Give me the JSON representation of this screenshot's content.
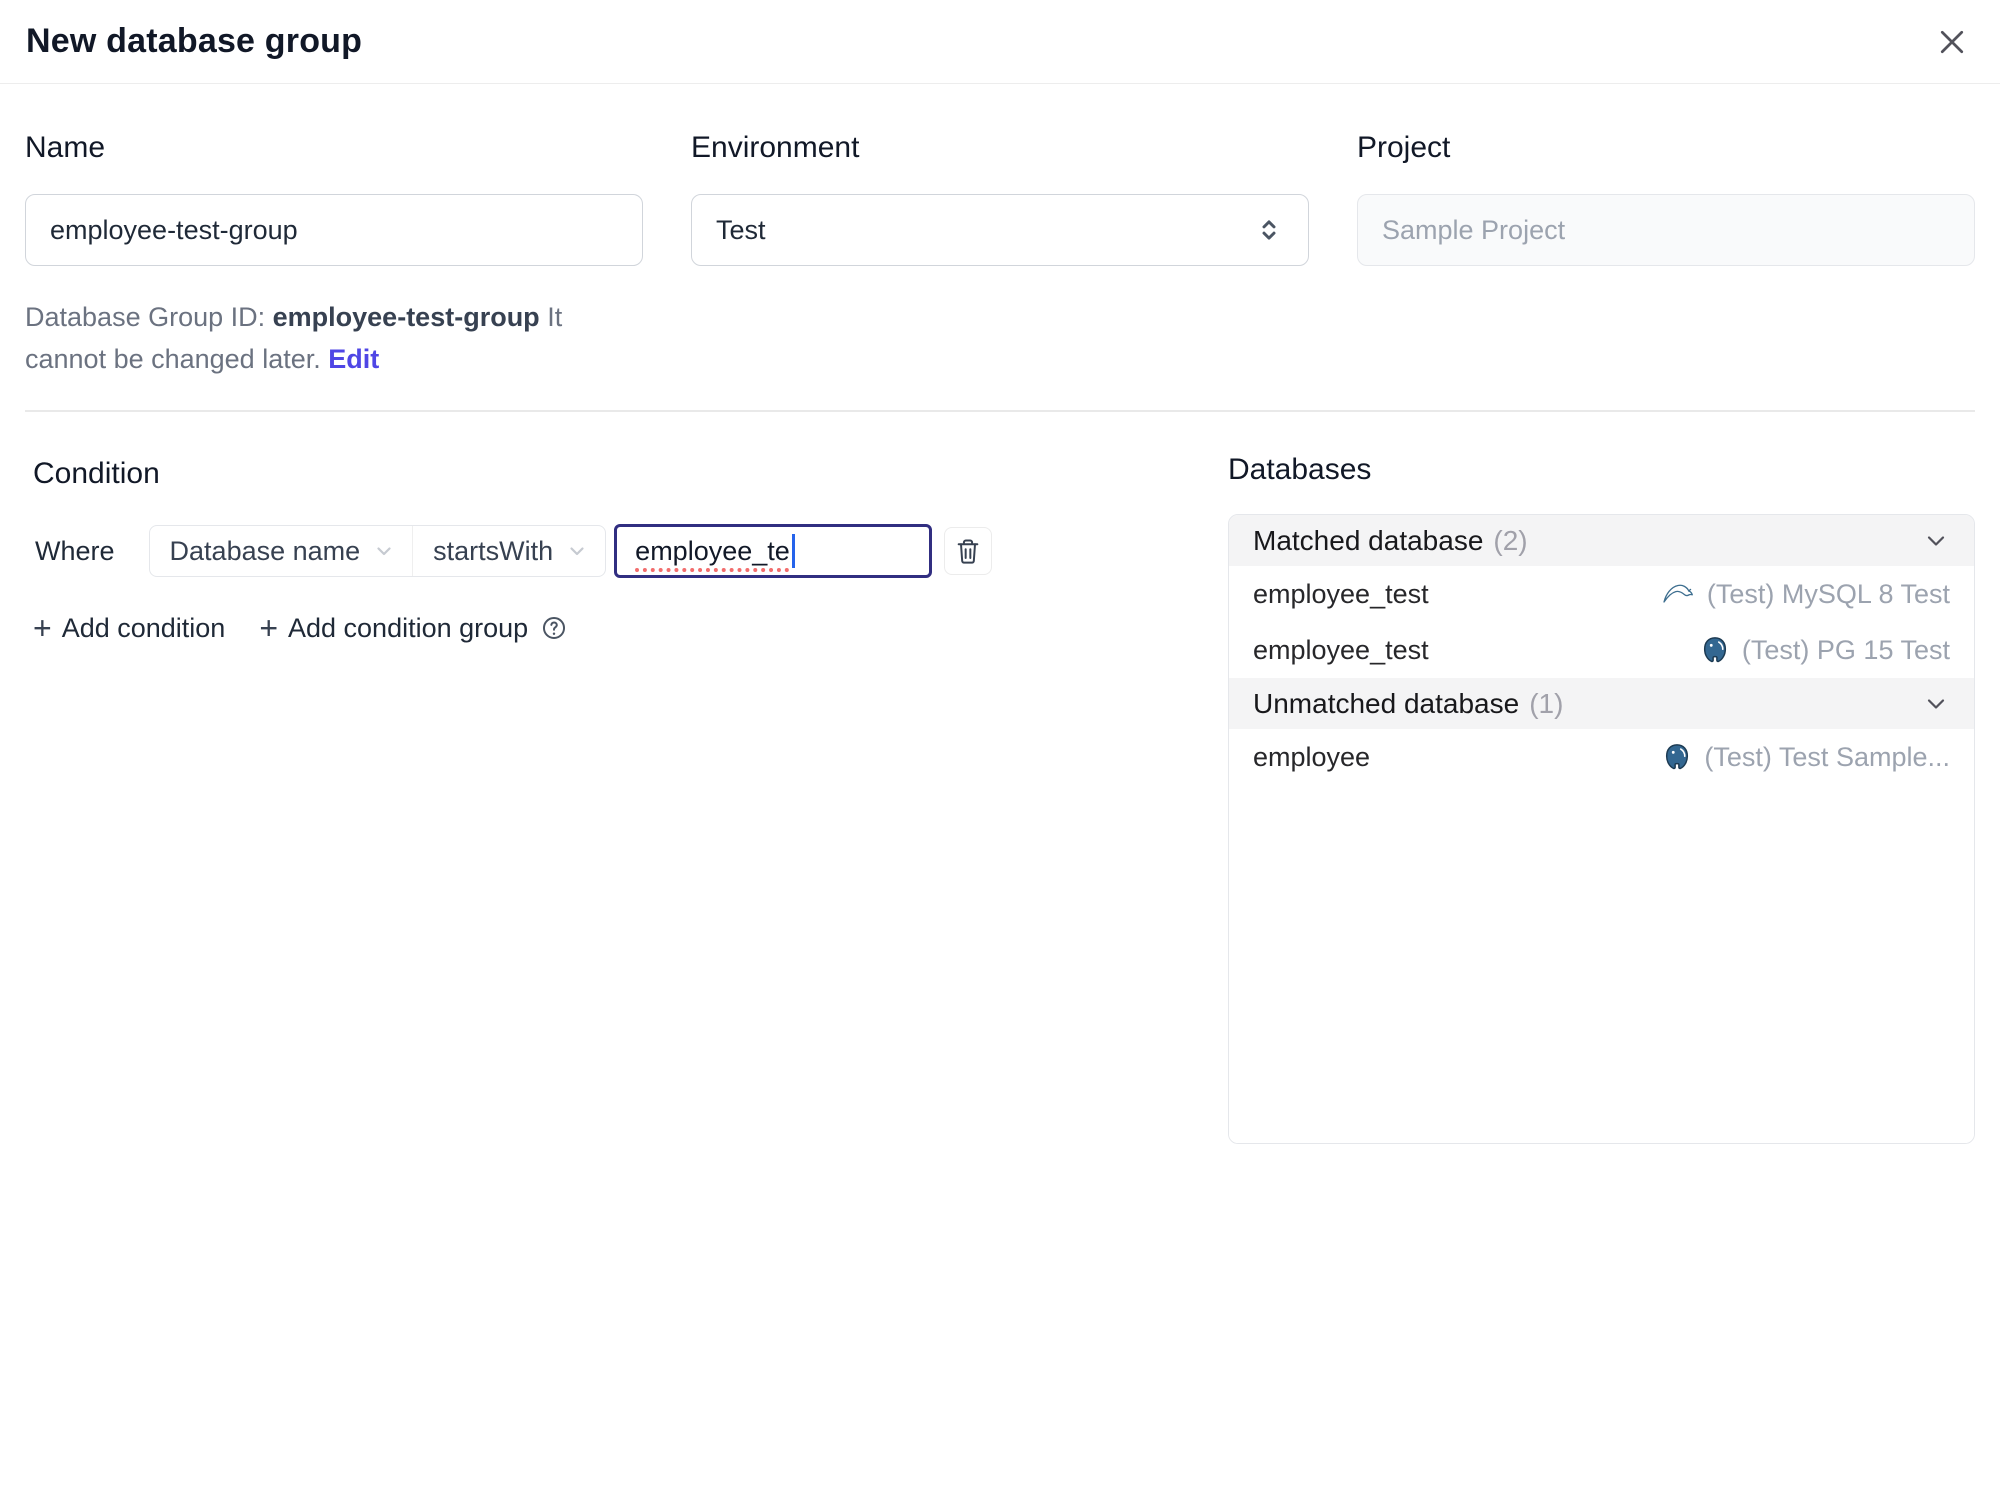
{
  "dialog": {
    "title": "New database group"
  },
  "form": {
    "name": {
      "label": "Name",
      "value": "employee-test-group"
    },
    "environment": {
      "label": "Environment",
      "value": "Test"
    },
    "project": {
      "label": "Project",
      "value": "Sample Project"
    },
    "id_helper": {
      "prefix": "Database Group ID: ",
      "id": "employee-test-group",
      "suffix": " It cannot be changed later. ",
      "edit_label": "Edit"
    }
  },
  "condition": {
    "heading": "Condition",
    "where_label": "Where",
    "field_selected": "Database name",
    "operator_selected": "startsWith",
    "value": "employee_te",
    "add_condition_label": "Add condition",
    "add_condition_group_label": "Add condition group"
  },
  "databases": {
    "heading": "Databases",
    "sections": [
      {
        "title": "Matched database",
        "count": "(2)",
        "rows": [
          {
            "name": "employee_test",
            "engine": "mysql",
            "instance": "(Test) MySQL 8 Test"
          },
          {
            "name": "employee_test",
            "engine": "postgres",
            "instance": "(Test) PG 15 Test"
          }
        ]
      },
      {
        "title": "Unmatched database",
        "count": "(1)",
        "rows": [
          {
            "name": "employee",
            "engine": "postgres",
            "instance": "(Test) Test Sample..."
          }
        ]
      }
    ]
  },
  "colors": {
    "accent_link": "#4f46e5",
    "focused_input_border": "#312e81",
    "spellcheck_underline": "#f26d6d",
    "caret": "#2563eb",
    "muted_text": "#9ca3af",
    "section_header_bg": "#f4f4f5",
    "mysql_icon": "#3d6e8f",
    "postgres_icon": "#336791"
  }
}
